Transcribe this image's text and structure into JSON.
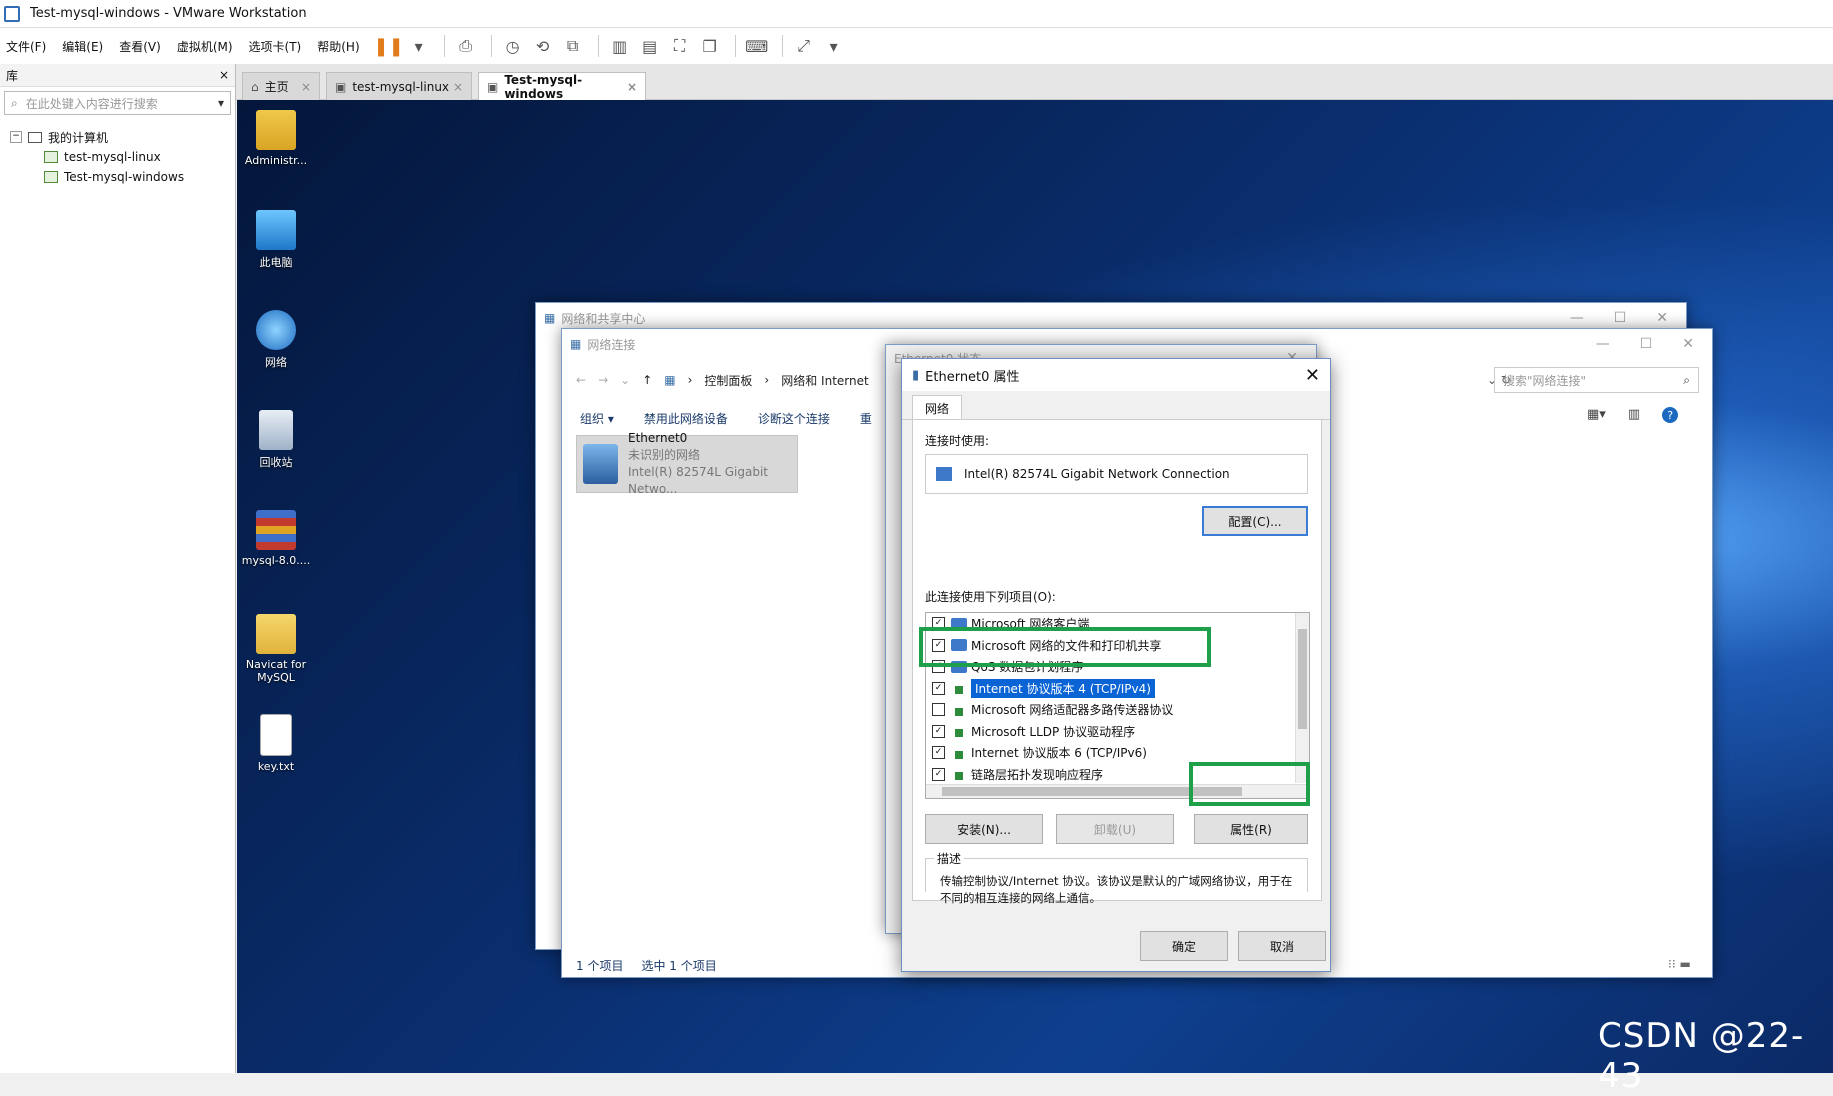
{
  "app": {
    "title": "Test-mysql-windows - VMware Workstation",
    "menus": [
      "文件(F)",
      "编辑(E)",
      "查看(V)",
      "虚拟机(M)",
      "选项卡(T)",
      "帮助(H)"
    ]
  },
  "library": {
    "header": "库",
    "close": "×",
    "search_placeholder": "在此处键入内容进行搜索",
    "tree_root": "我的计算机",
    "tree_items": [
      "test-mysql-linux",
      "Test-mysql-windows"
    ]
  },
  "tabs": [
    {
      "label": "主页"
    },
    {
      "label": "test-mysql-linux"
    },
    {
      "label": "Test-mysql-windows"
    }
  ],
  "desktop_icons": [
    {
      "label": "Administr...",
      "icon": "user-folder-icon"
    },
    {
      "label": "此电脑",
      "icon": "this-pc-icon"
    },
    {
      "label": "网络",
      "icon": "network-icon"
    },
    {
      "label": "回收站",
      "icon": "recycle-bin-icon"
    },
    {
      "label": "mysql-8.0....",
      "icon": "winrar-archive-icon"
    },
    {
      "label": "Navicat for MySQL",
      "icon": "folder-icon"
    },
    {
      "label": "key.txt",
      "icon": "text-file-icon"
    }
  ],
  "network_center": {
    "title": "网络和共享中心"
  },
  "network_connections": {
    "title": "网络连接",
    "breadcrumb": [
      "控制面板",
      "网络和 Internet"
    ],
    "search_placeholder": "搜索\"网络连接\"",
    "commands": [
      "组织 ▾",
      "禁用此网络设备",
      "诊断这个连接",
      "重"
    ],
    "adapter": {
      "name": "Ethernet0",
      "status": "未识别的网络",
      "device": "Intel(R) 82574L Gigabit Netwo..."
    },
    "status_left": "1 个项目",
    "status_right": "选中 1 个项目"
  },
  "ethernet_status": {
    "title": "Ethernet0 状态"
  },
  "properties": {
    "title": "Ethernet0 属性",
    "tab": "网络",
    "connect_using_label": "连接时使用:",
    "adapter_name": "Intel(R) 82574L Gigabit Network Connection",
    "configure_button": "配置(C)...",
    "items_label": "此连接使用下列项目(O):",
    "items": [
      {
        "label": "Microsoft 网络客户端",
        "checked": true
      },
      {
        "label": "Microsoft 网络的文件和打印机共享",
        "checked": true
      },
      {
        "label": "QoS 数据包计划程序",
        "checked": true
      },
      {
        "label": "Internet 协议版本 4 (TCP/IPv4)",
        "checked": true,
        "selected": true
      },
      {
        "label": "Microsoft 网络适配器多路传送器协议",
        "checked": false
      },
      {
        "label": "Microsoft LLDP 协议驱动程序",
        "checked": true
      },
      {
        "label": "Internet 协议版本 6 (TCP/IPv6)",
        "checked": true
      },
      {
        "label": "链路层拓扑发现响应程序",
        "checked": true
      }
    ],
    "install_button": "安装(N)...",
    "uninstall_button": "卸载(U)",
    "properties_button": "属性(R)",
    "description_label": "描述",
    "description_text": "传输控制协议/Internet 协议。该协议是默认的广域网络协议，用于在不同的相互连接的网络上通信。",
    "ok_button": "确定",
    "cancel_button": "取消"
  },
  "watermark": "CSDN @22-43",
  "colors": {
    "highlight": "#1ea04a",
    "selection": "#0a64d6"
  }
}
